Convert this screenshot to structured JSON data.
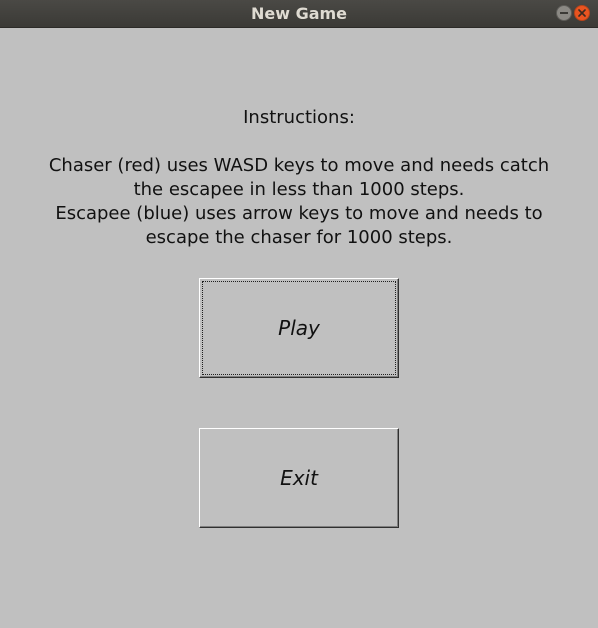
{
  "window": {
    "title": "New Game",
    "controls": {
      "minimize": "minimize-icon",
      "close": "close-icon",
      "close_color": "#e95420"
    }
  },
  "instructions": {
    "heading": "Instructions:",
    "lines": [
      "Chaser (red) uses WASD keys to move and needs catch",
      "the escapee in less than 1000 steps.",
      "Escapee (blue) uses arrow keys to move and needs to",
      "escape the chaser for 1000 steps."
    ]
  },
  "buttons": {
    "play_label": "Play",
    "exit_label": "Exit"
  },
  "colors": {
    "background": "#c0c0c0",
    "titlebar": "#3b3a36"
  }
}
